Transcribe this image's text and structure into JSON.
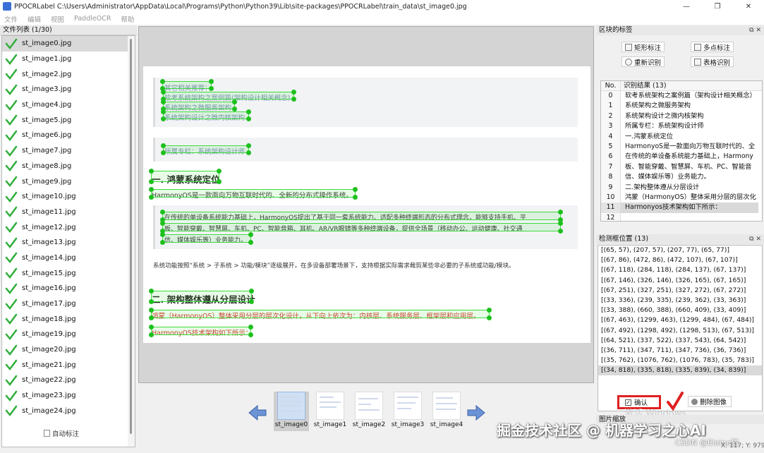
{
  "window": {
    "title": "PPOCRLabel C:\\Users\\Administrator\\AppData\\Local\\Programs\\Python\\Python39\\Lib\\site-packages\\PPOCRLabel\\train_data\\st_image0.jpg",
    "controls": [
      "—",
      "❐",
      "✕"
    ]
  },
  "menu": [
    "文件",
    "编辑",
    "视图",
    "PaddleOCR",
    "帮助"
  ],
  "file_panel": {
    "title": "文件列表 (1/30)",
    "files": [
      "st_image0.jpg",
      "st_image1.jpg",
      "st_image2.jpg",
      "st_image3.jpg",
      "st_image4.jpg",
      "st_image5.jpg",
      "st_image6.jpg",
      "st_image7.jpg",
      "st_image8.jpg",
      "st_image9.jpg",
      "st_image10.jpg",
      "st_image11.jpg",
      "st_image12.jpg",
      "st_image13.jpg",
      "st_image14.jpg",
      "st_image15.jpg",
      "st_image16.jpg",
      "st_image17.jpg",
      "st_image18.jpg",
      "st_image19.jpg",
      "st_image20.jpg",
      "st_image21.jpg",
      "st_image22.jpg",
      "st_image23.jpg",
      "st_image24.jpg"
    ],
    "selected_index": 0,
    "auto_label": "自动标注"
  },
  "document": {
    "lines": [
      {
        "text": "其它相关推荐：",
        "style": "link"
      },
      {
        "text": "软考系统架构之案例篇(架构设计相关概念)",
        "style": "link"
      },
      {
        "text": "系统架构之微服务架构",
        "style": "link"
      },
      {
        "text": "系统架构设计之微内核架构",
        "style": "link"
      },
      {
        "text": "所属专栏：系统架构设计师",
        "style": "link"
      },
      {
        "text": "一. 鸿蒙系统定位",
        "style": "h2"
      },
      {
        "text": "HarmonyOS是一款面向万物互联时代的、全新的分布式操作系统。",
        "style": "normal"
      },
      {
        "text": "在传统的单设备系统能力基础上，HarmonyOS提出了基于同一套系统能力、适配多种终端形态的分布式理念，能够支持手机、平",
        "style": "normal"
      },
      {
        "text": "板、智能穿戴、智慧屏、车机、PC、智能音箱、耳机、AR/VR眼镜等多种终端设备，提供全场景（移动办公、运动健康、社交通",
        "style": "normal"
      },
      {
        "text": "信、媒体娱乐等）业务能力。",
        "style": "normal"
      },
      {
        "text": "系统功能按照“系统 > 子系统 > 功能/模块”逐级展开，在多设备部署场景下，支持根据实际需求裁剪某些非必要的子系统或功能/模块。",
        "style": "normal"
      },
      {
        "text": "二. 架构整体遵从分层设计",
        "style": "h2"
      },
      {
        "text": "鸿蒙（HarmonyOS）整体采用分层的层次化设计，从下向上依次为：内核层、系统服务层、框架层和应用层。",
        "style": "red"
      },
      {
        "text": "HarmonyOS技术架构如下所示：",
        "style": "red"
      }
    ]
  },
  "thumbnails": {
    "items": [
      "st_image0",
      "st_image1",
      "st_image2",
      "st_image3",
      "st_image4"
    ],
    "selected_index": 0
  },
  "block_panel": {
    "title": "区块的标签",
    "buttons": {
      "rect": "矩形标注",
      "poly": "多点标注",
      "reocr": "重新识别",
      "table": "表格识别"
    }
  },
  "results": {
    "col_no": "No.",
    "col_result": "识别结果 (13)",
    "rows": [
      "软考系统架构之案例篇（架构设计相关概念）",
      "系统架构之微服务架构",
      "系统架构设计之微内核架构",
      "所属专栏：系统架构设计师",
      "一.鸿蒙系统定位",
      "HarmonyoS是一款面向万物互联时代的、全",
      "在传统的单设备系统能力基础上，Harmony",
      "板、智能穿戴、智慧屏、车机、PC、智能音",
      "信、媒体娱乐等）业务能力。",
      "二.架构整体遵从分层设计",
      "鸿蒙（HarmonyOS）整体采用分层的层次化",
      "Harmonyos技术架构如下所示：",
      ""
    ],
    "selected_index": 11
  },
  "detect_panel": {
    "title": "检测框位置 (13)",
    "boxes": [
      "[(65, 57), (207, 57), (207, 77), (65, 77)]",
      "[(67, 86), (472, 86), (472, 107), (67, 107)]",
      "[(67, 118), (284, 118), (284, 137), (67, 137)]",
      "[(67, 146), (326, 146), (326, 165), (67, 165)]",
      "[(67, 251), (327, 251), (327, 272), (67, 272)]",
      "[(33, 336), (239, 335), (239, 362), (33, 363)]",
      "[(33, 388), (660, 388), (660, 409), (33, 409)]",
      "[(67, 463), (1299, 463), (1299, 484), (67, 484)]",
      "[(67, 492), (1298, 492), (1298, 513), (67, 513)]",
      "[(64, 521), (337, 522), (337, 543), (64, 542)]",
      "[(36, 711), (347, 711), (347, 736), (36, 736)]",
      "[(35, 762), (1076, 762), (1076, 783), (35, 783)]",
      "[(34, 818), (335, 818), (335, 839), (34, 839)]"
    ],
    "selected_index": 12
  },
  "actions": {
    "confirm": "确认",
    "delete": "删除图像"
  },
  "zoom_title": "图片缩放",
  "ghost_text": "激活 Windows",
  "overlay": {
    "watermark": "掘金技术社区 @ 机器学习之心AI",
    "csdn": "CSDN @Elaine猿",
    "coords": "X: 117; Y: 979"
  },
  "colors": {
    "box_green": "#3ddc3d",
    "highlight_red": "#e02020",
    "check_green": "#2fae3a"
  }
}
